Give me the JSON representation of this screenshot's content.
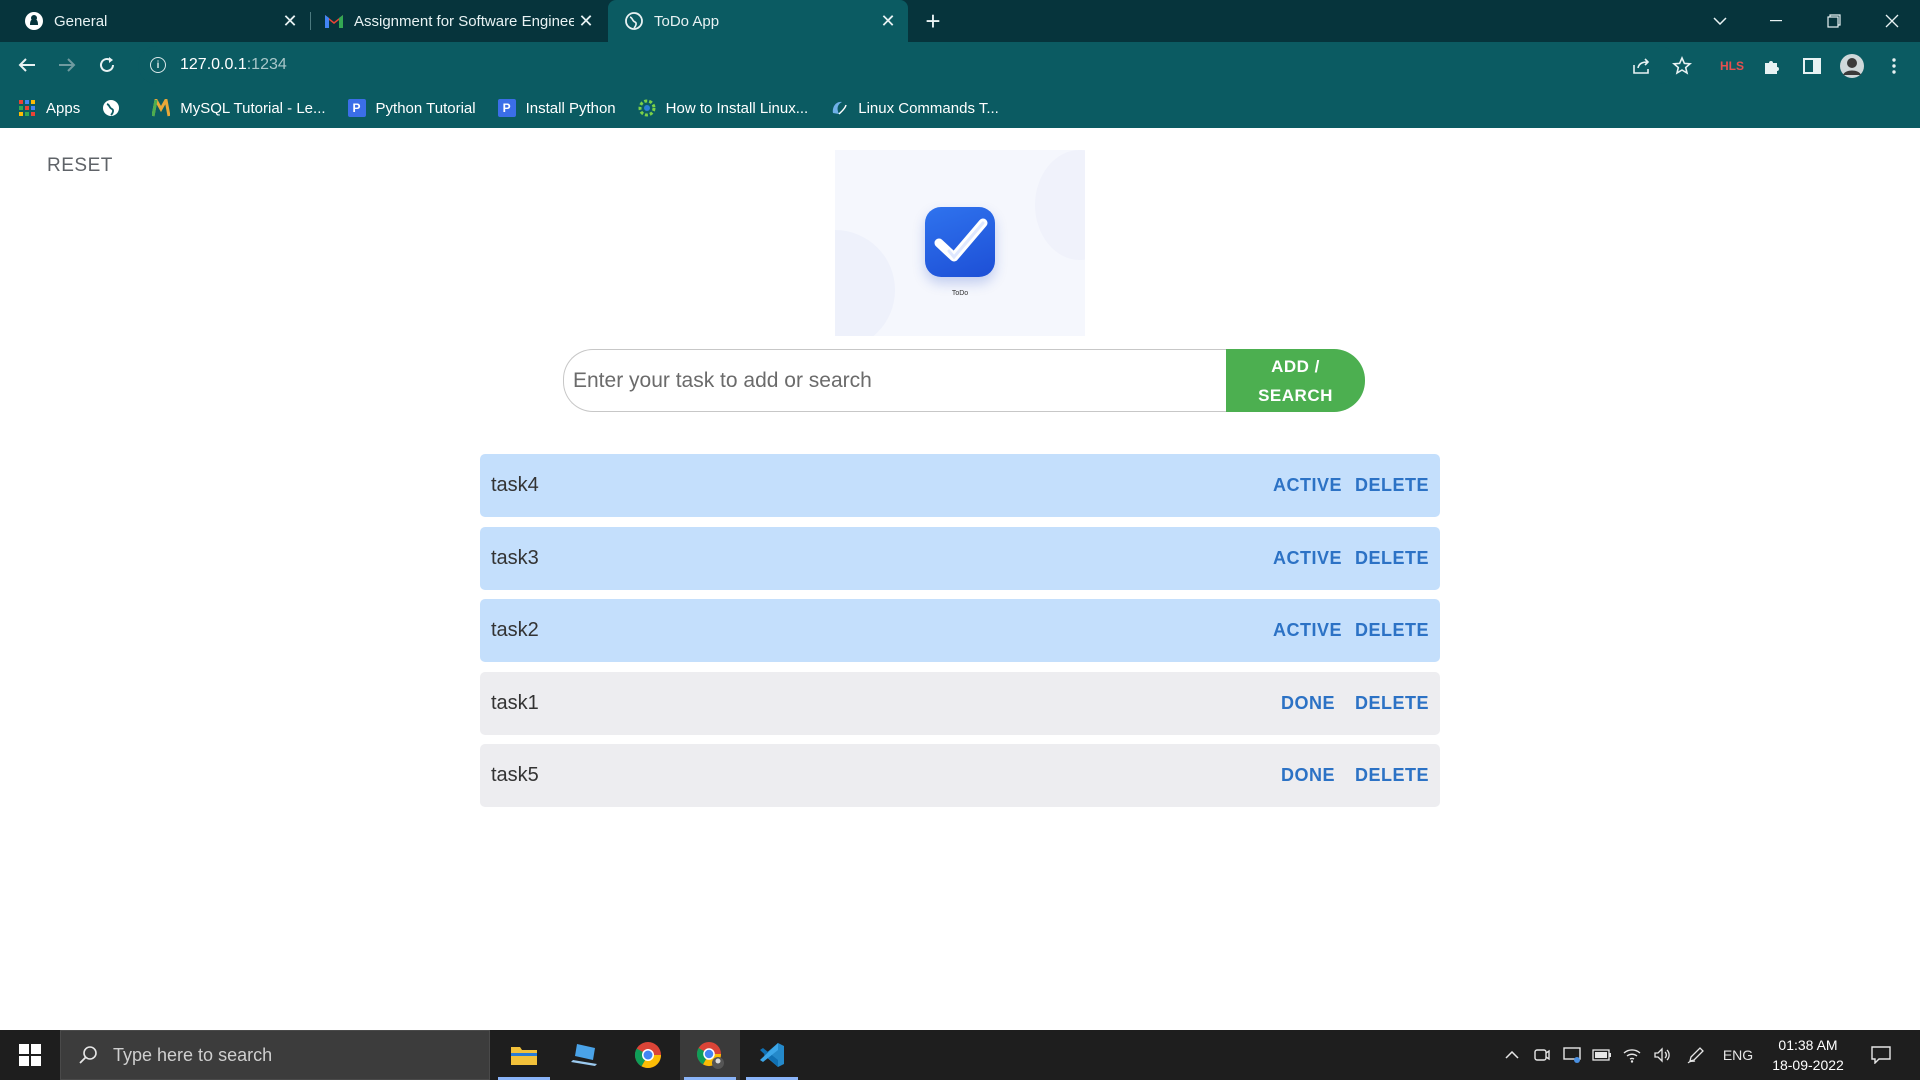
{
  "browser": {
    "tabs": [
      {
        "title": "General",
        "icon": "github-icon"
      },
      {
        "title": "Assignment for Software Enginee",
        "icon": "gmail-icon"
      },
      {
        "title": "ToDo App",
        "icon": "globe-icon"
      }
    ],
    "url_host": "127.0.0.1",
    "url_port": ":1234",
    "bookmarks": [
      {
        "label": "Apps",
        "icon": "apps-grid-icon"
      },
      {
        "label": "",
        "icon": "globe-icon"
      },
      {
        "label": "MySQL Tutorial - Le...",
        "icon": "mysql-icon"
      },
      {
        "label": "Python Tutorial",
        "icon": "p-icon"
      },
      {
        "label": "Install Python",
        "icon": "p-icon"
      },
      {
        "label": "How to Install Linux...",
        "icon": "gear-flower-icon"
      },
      {
        "label": "Linux Commands T...",
        "icon": "linux-icon"
      }
    ],
    "toolbar_badge": "HLS"
  },
  "page": {
    "reset_label": "RESET",
    "logo_caption": "ToDo",
    "input_placeholder": "Enter your task to add or search",
    "add_button_line1": "ADD /",
    "add_button_line2": "SEARCH",
    "tasks": [
      {
        "name": "task4",
        "status": "active",
        "toggle_label": "ACTIVE",
        "delete_label": "DELETE"
      },
      {
        "name": "task3",
        "status": "active",
        "toggle_label": "ACTIVE",
        "delete_label": "DELETE"
      },
      {
        "name": "task2",
        "status": "active",
        "toggle_label": "ACTIVE",
        "delete_label": "DELETE"
      },
      {
        "name": "task1",
        "status": "done",
        "toggle_label": "DONE",
        "delete_label": "DELETE"
      },
      {
        "name": "task5",
        "status": "done",
        "toggle_label": "DONE",
        "delete_label": "DELETE"
      }
    ]
  },
  "taskbar": {
    "search_placeholder": "Type here to search",
    "language": "ENG",
    "time": "01:38 AM",
    "date": "18-09-2022"
  },
  "colors": {
    "chrome_dark": "#06343c",
    "chrome": "#0b5b62",
    "active_task_bg": "#c4dffc",
    "done_task_bg": "#ededf0",
    "action_text": "#2c72c5",
    "add_button": "#4caf50"
  }
}
